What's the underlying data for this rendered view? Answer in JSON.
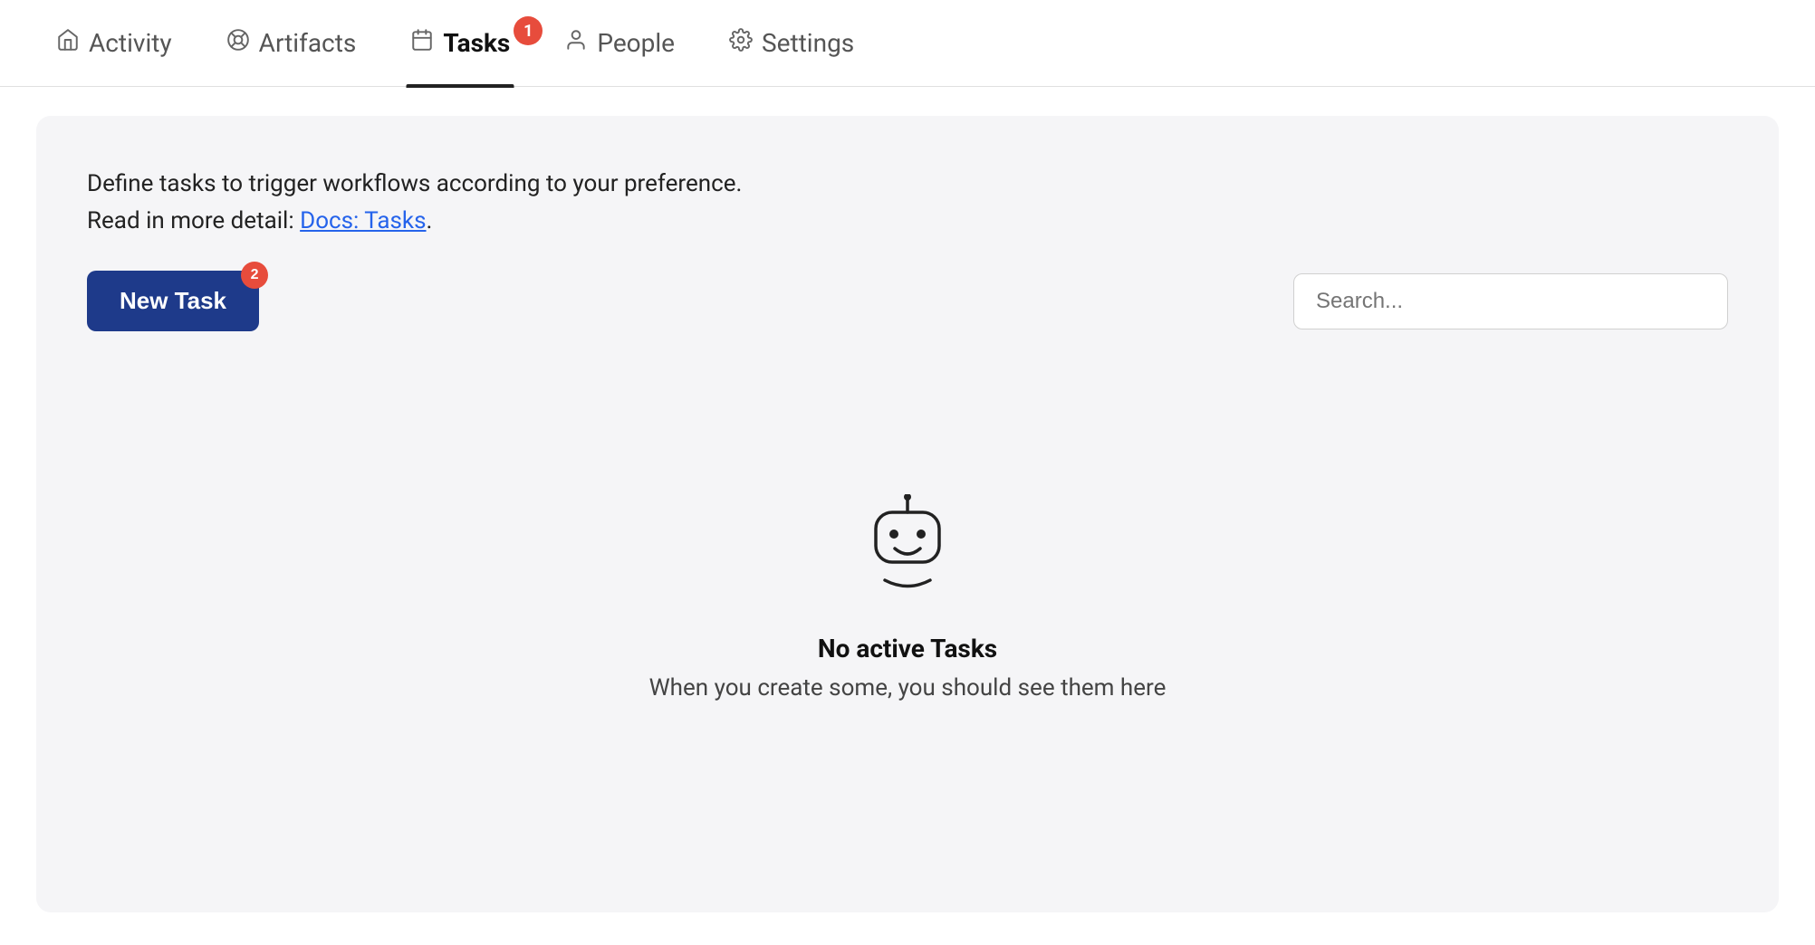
{
  "nav": {
    "tabs": [
      {
        "id": "activity",
        "label": "Activity",
        "icon": "🏠",
        "active": false
      },
      {
        "id": "artifacts",
        "label": "Artifacts",
        "icon": "⚙️",
        "active": false
      },
      {
        "id": "tasks",
        "label": "Tasks",
        "icon": "📅",
        "active": true,
        "badge": "1"
      },
      {
        "id": "people",
        "label": "People",
        "icon": "👤",
        "active": false
      },
      {
        "id": "settings",
        "label": "Settings",
        "icon": "⚙️",
        "active": false
      }
    ]
  },
  "content": {
    "description_line1": "Define tasks to trigger workflows according to your preference.",
    "description_line2": "Read in more detail: ",
    "docs_link_text": "Docs: Tasks",
    "docs_link_suffix": ".",
    "new_task_button": "New Task",
    "new_task_badge": "2",
    "search_placeholder": "Search...",
    "empty_state": {
      "title": "No active Tasks",
      "subtitle": "When you create some, you should see them here"
    }
  }
}
